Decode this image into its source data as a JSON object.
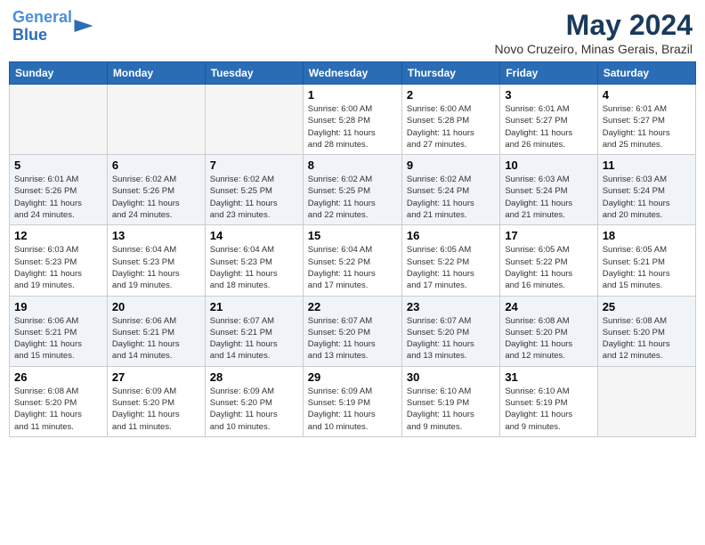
{
  "logo": {
    "line1": "General",
    "line2": "Blue"
  },
  "title": "May 2024",
  "subtitle": "Novo Cruzeiro, Minas Gerais, Brazil",
  "days_of_week": [
    "Sunday",
    "Monday",
    "Tuesday",
    "Wednesday",
    "Thursday",
    "Friday",
    "Saturday"
  ],
  "weeks": [
    {
      "alt": false,
      "days": [
        {
          "num": "",
          "info": ""
        },
        {
          "num": "",
          "info": ""
        },
        {
          "num": "",
          "info": ""
        },
        {
          "num": "1",
          "info": "Sunrise: 6:00 AM\nSunset: 5:28 PM\nDaylight: 11 hours\nand 28 minutes."
        },
        {
          "num": "2",
          "info": "Sunrise: 6:00 AM\nSunset: 5:28 PM\nDaylight: 11 hours\nand 27 minutes."
        },
        {
          "num": "3",
          "info": "Sunrise: 6:01 AM\nSunset: 5:27 PM\nDaylight: 11 hours\nand 26 minutes."
        },
        {
          "num": "4",
          "info": "Sunrise: 6:01 AM\nSunset: 5:27 PM\nDaylight: 11 hours\nand 25 minutes."
        }
      ]
    },
    {
      "alt": true,
      "days": [
        {
          "num": "5",
          "info": "Sunrise: 6:01 AM\nSunset: 5:26 PM\nDaylight: 11 hours\nand 24 minutes."
        },
        {
          "num": "6",
          "info": "Sunrise: 6:02 AM\nSunset: 5:26 PM\nDaylight: 11 hours\nand 24 minutes."
        },
        {
          "num": "7",
          "info": "Sunrise: 6:02 AM\nSunset: 5:25 PM\nDaylight: 11 hours\nand 23 minutes."
        },
        {
          "num": "8",
          "info": "Sunrise: 6:02 AM\nSunset: 5:25 PM\nDaylight: 11 hours\nand 22 minutes."
        },
        {
          "num": "9",
          "info": "Sunrise: 6:02 AM\nSunset: 5:24 PM\nDaylight: 11 hours\nand 21 minutes."
        },
        {
          "num": "10",
          "info": "Sunrise: 6:03 AM\nSunset: 5:24 PM\nDaylight: 11 hours\nand 21 minutes."
        },
        {
          "num": "11",
          "info": "Sunrise: 6:03 AM\nSunset: 5:24 PM\nDaylight: 11 hours\nand 20 minutes."
        }
      ]
    },
    {
      "alt": false,
      "days": [
        {
          "num": "12",
          "info": "Sunrise: 6:03 AM\nSunset: 5:23 PM\nDaylight: 11 hours\nand 19 minutes."
        },
        {
          "num": "13",
          "info": "Sunrise: 6:04 AM\nSunset: 5:23 PM\nDaylight: 11 hours\nand 19 minutes."
        },
        {
          "num": "14",
          "info": "Sunrise: 6:04 AM\nSunset: 5:23 PM\nDaylight: 11 hours\nand 18 minutes."
        },
        {
          "num": "15",
          "info": "Sunrise: 6:04 AM\nSunset: 5:22 PM\nDaylight: 11 hours\nand 17 minutes."
        },
        {
          "num": "16",
          "info": "Sunrise: 6:05 AM\nSunset: 5:22 PM\nDaylight: 11 hours\nand 17 minutes."
        },
        {
          "num": "17",
          "info": "Sunrise: 6:05 AM\nSunset: 5:22 PM\nDaylight: 11 hours\nand 16 minutes."
        },
        {
          "num": "18",
          "info": "Sunrise: 6:05 AM\nSunset: 5:21 PM\nDaylight: 11 hours\nand 15 minutes."
        }
      ]
    },
    {
      "alt": true,
      "days": [
        {
          "num": "19",
          "info": "Sunrise: 6:06 AM\nSunset: 5:21 PM\nDaylight: 11 hours\nand 15 minutes."
        },
        {
          "num": "20",
          "info": "Sunrise: 6:06 AM\nSunset: 5:21 PM\nDaylight: 11 hours\nand 14 minutes."
        },
        {
          "num": "21",
          "info": "Sunrise: 6:07 AM\nSunset: 5:21 PM\nDaylight: 11 hours\nand 14 minutes."
        },
        {
          "num": "22",
          "info": "Sunrise: 6:07 AM\nSunset: 5:20 PM\nDaylight: 11 hours\nand 13 minutes."
        },
        {
          "num": "23",
          "info": "Sunrise: 6:07 AM\nSunset: 5:20 PM\nDaylight: 11 hours\nand 13 minutes."
        },
        {
          "num": "24",
          "info": "Sunrise: 6:08 AM\nSunset: 5:20 PM\nDaylight: 11 hours\nand 12 minutes."
        },
        {
          "num": "25",
          "info": "Sunrise: 6:08 AM\nSunset: 5:20 PM\nDaylight: 11 hours\nand 12 minutes."
        }
      ]
    },
    {
      "alt": false,
      "days": [
        {
          "num": "26",
          "info": "Sunrise: 6:08 AM\nSunset: 5:20 PM\nDaylight: 11 hours\nand 11 minutes."
        },
        {
          "num": "27",
          "info": "Sunrise: 6:09 AM\nSunset: 5:20 PM\nDaylight: 11 hours\nand 11 minutes."
        },
        {
          "num": "28",
          "info": "Sunrise: 6:09 AM\nSunset: 5:20 PM\nDaylight: 11 hours\nand 10 minutes."
        },
        {
          "num": "29",
          "info": "Sunrise: 6:09 AM\nSunset: 5:19 PM\nDaylight: 11 hours\nand 10 minutes."
        },
        {
          "num": "30",
          "info": "Sunrise: 6:10 AM\nSunset: 5:19 PM\nDaylight: 11 hours\nand 9 minutes."
        },
        {
          "num": "31",
          "info": "Sunrise: 6:10 AM\nSunset: 5:19 PM\nDaylight: 11 hours\nand 9 minutes."
        },
        {
          "num": "",
          "info": ""
        }
      ]
    }
  ]
}
